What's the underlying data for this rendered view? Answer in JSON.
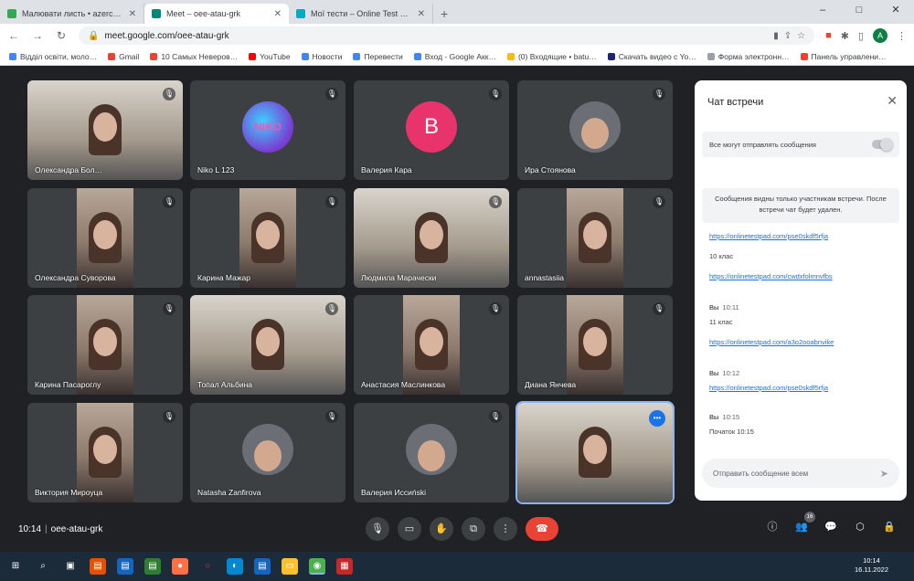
{
  "browser": {
    "tabs": [
      {
        "title": "Малювати листь • azercasvanov…",
        "active": false,
        "fav_color": "#34a853"
      },
      {
        "title": "Meet – oee-atau-grk",
        "active": true,
        "fav_color": "#00897b"
      },
      {
        "title": "Мої тести – Online Test Pad",
        "active": false,
        "fav_color": "#00acc1"
      }
    ],
    "new_tab": "+",
    "url": "meet.google.com/oee-atau-grk",
    "profile_letter": "A",
    "window_controls": [
      "–",
      "□",
      "✕"
    ],
    "bookmarks": [
      {
        "label": "Відділ освіти, моло…",
        "color": "#4285f4"
      },
      {
        "label": "Gmail",
        "color": "#ea4335"
      },
      {
        "label": "10 Самых Неверов…",
        "color": "#ea4335"
      },
      {
        "label": "YouTube",
        "color": "#ff0000"
      },
      {
        "label": "Новости",
        "color": "#4285f4"
      },
      {
        "label": "Перевести",
        "color": "#4285f4"
      },
      {
        "label": "Вход - Google Акк…",
        "color": "#4285f4"
      },
      {
        "label": "(0) Входящие • batu…",
        "color": "#fbbc04"
      },
      {
        "label": "Скачать видео с Yo…",
        "color": "#1a237e"
      },
      {
        "label": "Форма электронн…",
        "color": "#9aa0a6"
      },
      {
        "label": "Панель управлени…",
        "color": "#ea4335"
      }
    ]
  },
  "participants": [
    {
      "name": "Олександра Бол…",
      "kind": "wide"
    },
    {
      "name": "Niko L 123",
      "kind": "logo",
      "avatar_text": "NIKO"
    },
    {
      "name": "Валерия Кара",
      "kind": "letter",
      "avatar_text": "B"
    },
    {
      "name": "Ира Стоянова",
      "kind": "photo"
    },
    {
      "name": "Олександра Суворова",
      "kind": "video"
    },
    {
      "name": "Карина Мажар",
      "kind": "video"
    },
    {
      "name": "Людмила Марачески",
      "kind": "wide"
    },
    {
      "name": "annastasiia",
      "kind": "video"
    },
    {
      "name": "Карина Пасароглу",
      "kind": "video"
    },
    {
      "name": "Топал Альбина",
      "kind": "wide"
    },
    {
      "name": "Анастасия Маслинкова",
      "kind": "video"
    },
    {
      "name": "Диана Янчева",
      "kind": "video"
    },
    {
      "name": "Виктория Мироуца",
      "kind": "video"
    },
    {
      "name": "Natasha Zanfirova",
      "kind": "photo"
    },
    {
      "name": "Валерия Иссиński",
      "kind": "photo"
    },
    {
      "name": "",
      "kind": "wide",
      "speaking": true
    }
  ],
  "chat": {
    "title": "Чат встречи",
    "toggle_label": "Все могут отправлять сообщения",
    "notice": "Сообщения видны только участникам встречи. После встречи чат будет удален.",
    "messages": [
      {
        "type": "link",
        "text": "https://onlinetestpad.com/pse0skdf5rfja"
      },
      {
        "type": "text",
        "text": "10 клас"
      },
      {
        "type": "link",
        "text": "https://onlinetestpad.com/cwdxfolmnvfbs"
      },
      {
        "type": "sender",
        "text": "Вы",
        "time": "10:11"
      },
      {
        "type": "text",
        "text": "11 клас"
      },
      {
        "type": "link",
        "text": "https://onlinetestpad.com/a3o2ooabnvike"
      },
      {
        "type": "sender",
        "text": "Вы",
        "time": "10:12"
      },
      {
        "type": "link",
        "text": "https://onlinetestpad.com/pse0skdf5rfja"
      },
      {
        "type": "sender",
        "text": "Вы",
        "time": "10:15"
      },
      {
        "type": "text",
        "text": "Початок 10:15"
      }
    ],
    "input_placeholder": "Отправить сообщение всем"
  },
  "bottom_bar": {
    "time": "10:14",
    "meeting_code": "oee-atau-grk",
    "participant_count": "16"
  },
  "taskbar": {
    "time": "10:14",
    "date": "16.11.2022"
  }
}
